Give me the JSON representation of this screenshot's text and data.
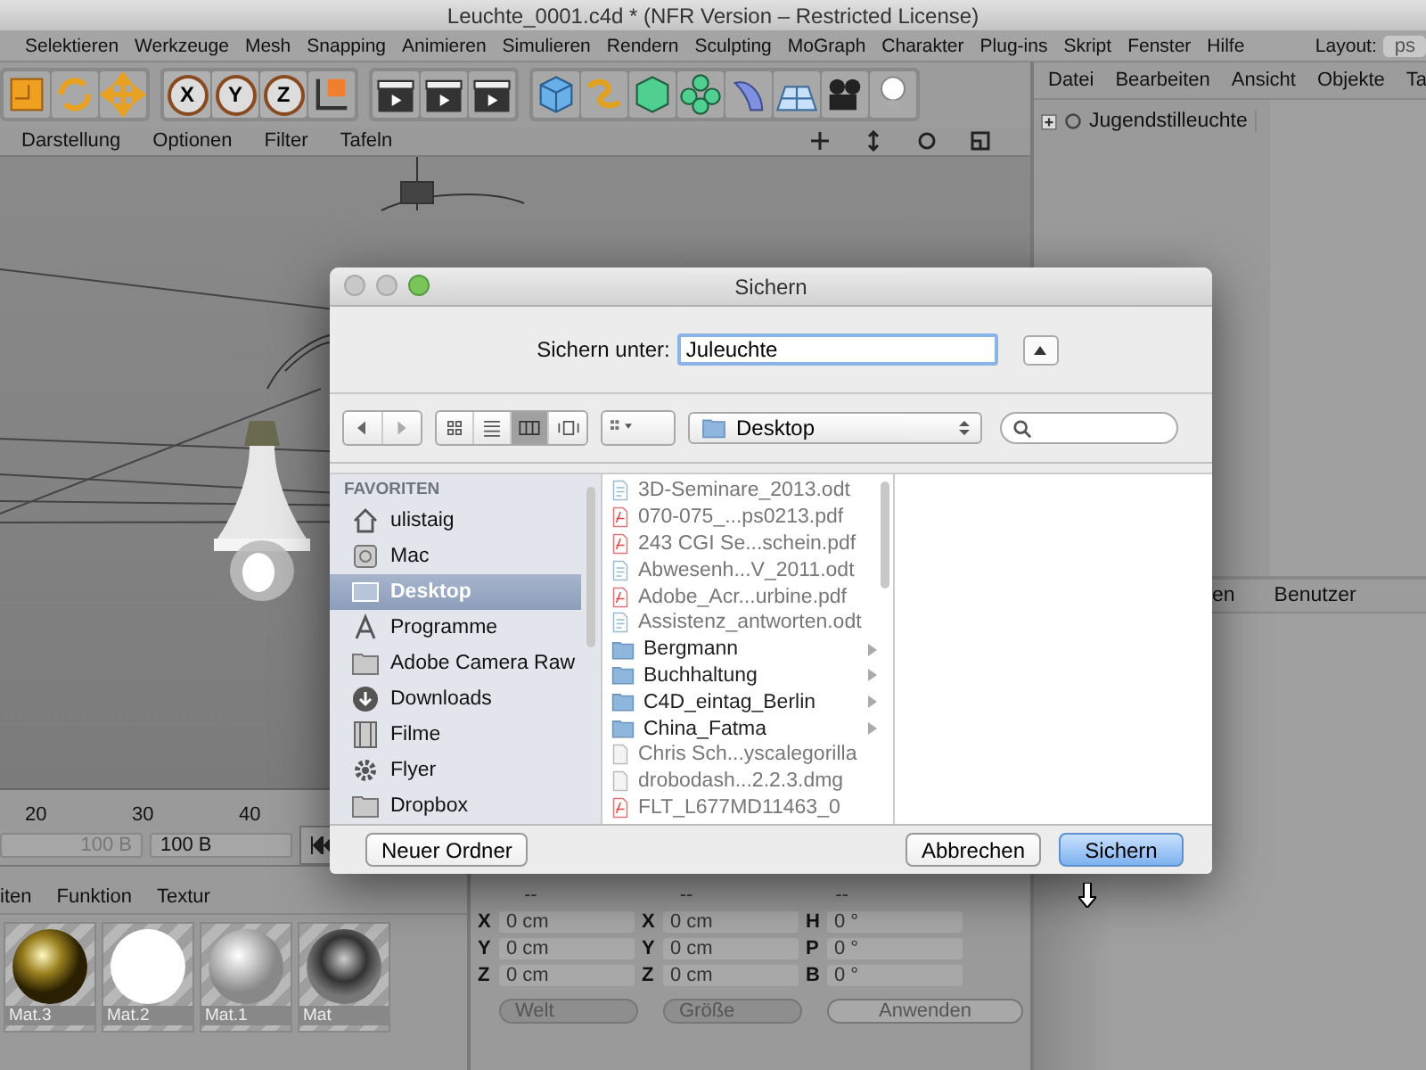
{
  "window": {
    "title": "Leuchte_0001.c4d * (NFR Version – Restricted License)"
  },
  "menu_bar": {
    "items": [
      "Selektieren",
      "Werkzeuge",
      "Mesh",
      "Snapping",
      "Animieren",
      "Simulieren",
      "Rendern",
      "Sculpting",
      "MoGraph",
      "Charakter",
      "Plug-ins",
      "Skript",
      "Fenster",
      "Hilfe"
    ],
    "layout_label": "Layout:",
    "layout_value": "ps"
  },
  "toolbar": {
    "axis_locks": [
      "X",
      "Y",
      "Z"
    ]
  },
  "object_manager": {
    "menus": [
      "Datei",
      "Bearbeiten",
      "Ansicht",
      "Objekte",
      "Ta"
    ],
    "objects": [
      {
        "name": "Jugendstilleuchte"
      }
    ]
  },
  "viewport": {
    "menus": [
      "Darstellung",
      "Optionen",
      "Filter",
      "Tafeln"
    ]
  },
  "attribute_manager": {
    "tabs": [
      "en",
      "Benutzer"
    ]
  },
  "timeline": {
    "ruler": [
      "20",
      "30",
      "40"
    ],
    "frame_fields": [
      "100 B",
      "100 B"
    ]
  },
  "material_manager": {
    "menus": [
      "iten",
      "Funktion",
      "Textur"
    ],
    "materials": [
      {
        "name": "Mat.3",
        "kind": "gold"
      },
      {
        "name": "Mat.2",
        "kind": "white"
      },
      {
        "name": "Mat.1",
        "kind": "glass"
      },
      {
        "name": "Mat",
        "kind": "chrome"
      }
    ]
  },
  "coordinates": {
    "headers": [
      "--",
      "--",
      "--"
    ],
    "rows": [
      {
        "p_axis": "X",
        "position": "0 cm",
        "s_axis": "X",
        "size": "0 cm",
        "r_axis": "H",
        "rotation": "0 °"
      },
      {
        "p_axis": "Y",
        "position": "0 cm",
        "s_axis": "Y",
        "size": "0 cm",
        "r_axis": "P",
        "rotation": "0 °"
      },
      {
        "p_axis": "Z",
        "position": "0 cm",
        "s_axis": "Z",
        "size": "0 cm",
        "r_axis": "B",
        "rotation": "0 °"
      }
    ],
    "dropdowns": [
      "Welt",
      "Größe"
    ],
    "apply_button": "Anwenden"
  },
  "dialog": {
    "title": "Sichern",
    "save_as_label": "Sichern unter:",
    "file_name": "Juleuchte",
    "view_modes": [
      {
        "kind": "icons",
        "selected": false
      },
      {
        "kind": "list",
        "selected": false
      },
      {
        "kind": "columns",
        "selected": true
      },
      {
        "kind": "coverflow",
        "selected": false
      }
    ],
    "location": "Desktop",
    "sidebar_header": "FAVORITEN",
    "sidebar": [
      {
        "name": "ulistaig",
        "kind": "home",
        "selected": false
      },
      {
        "name": "Mac",
        "kind": "drive",
        "selected": false
      },
      {
        "name": "Desktop",
        "kind": "desktop",
        "selected": true
      },
      {
        "name": "Programme",
        "kind": "apps",
        "selected": false
      },
      {
        "name": "Adobe Camera Raw",
        "kind": "folder",
        "selected": false
      },
      {
        "name": "Downloads",
        "kind": "download",
        "selected": false
      },
      {
        "name": "Filme",
        "kind": "film",
        "selected": false
      },
      {
        "name": "Flyer",
        "kind": "gear",
        "selected": false
      },
      {
        "name": "Dropbox",
        "kind": "folder",
        "selected": false
      }
    ],
    "files": [
      {
        "name": "3D-Seminare_2013.odt",
        "kind": "document"
      },
      {
        "name": "070-075_...ps0213.pdf",
        "kind": "pdf"
      },
      {
        "name": "243 CGI Se...schein.pdf",
        "kind": "pdf"
      },
      {
        "name": "Abwesenh...V_2011.odt",
        "kind": "document"
      },
      {
        "name": "Adobe_Acr...urbine.pdf",
        "kind": "pdf"
      },
      {
        "name": "Assistenz_antworten.odt",
        "kind": "document"
      },
      {
        "name": "Bergmann",
        "kind": "folder"
      },
      {
        "name": "Buchhaltung",
        "kind": "folder"
      },
      {
        "name": "C4D_eintag_Berlin",
        "kind": "folder"
      },
      {
        "name": "China_Fatma",
        "kind": "folder"
      },
      {
        "name": "Chris Sch...yscalegorilla",
        "kind": "file"
      },
      {
        "name": "drobodash...2.2.3.dmg",
        "kind": "file"
      },
      {
        "name": "FLT_L677MD11463_0",
        "kind": "pdf"
      }
    ],
    "buttons": [
      {
        "label": "Neuer Ordner",
        "kind": "plain"
      },
      {
        "label": "Abbrechen",
        "kind": "plain"
      },
      {
        "label": "Sichern",
        "kind": "default"
      }
    ]
  }
}
